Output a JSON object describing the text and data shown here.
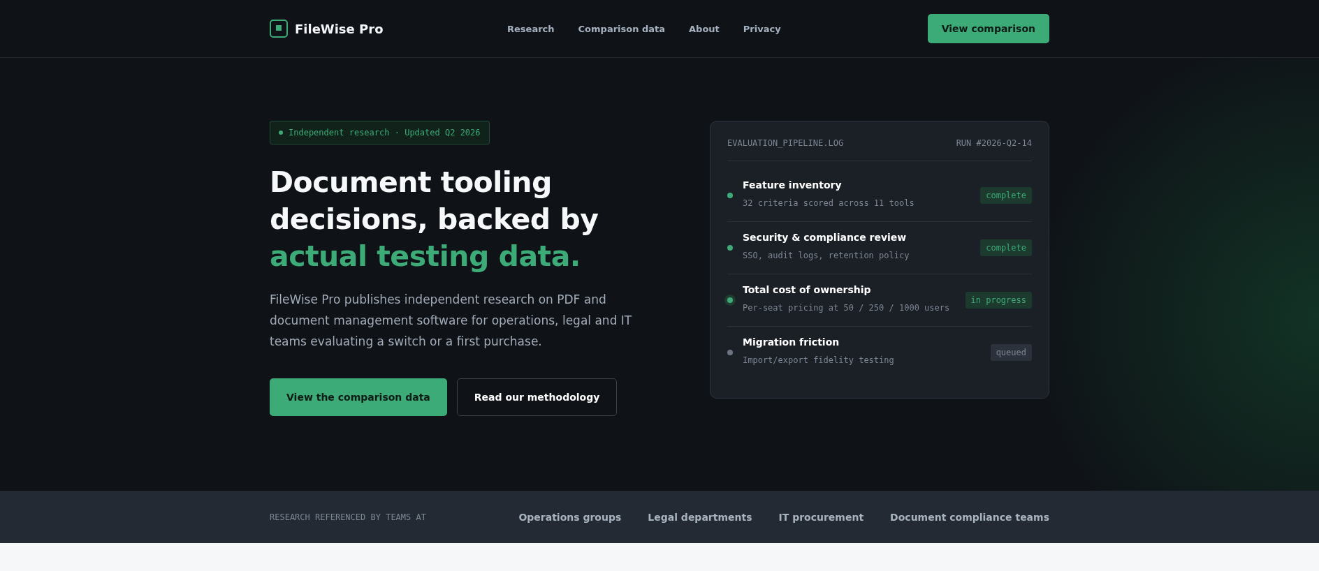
{
  "header": {
    "brand": "FileWise Pro",
    "nav": [
      "Research",
      "Comparison data",
      "About",
      "Privacy"
    ],
    "cta": "View comparison"
  },
  "hero": {
    "badge": "Independent research · Updated Q2 2026",
    "heading": "Document tooling decisions, backed by",
    "heading_accent": "actual testing data.",
    "intro": "FileWise Pro publishes independent research on PDF and document management software for operations, legal and IT teams evaluating a switch or a first purchase.",
    "primary_button": "View the comparison data",
    "secondary_button": "Read our methodology"
  },
  "panel": {
    "file": "EVALUATION_PIPELINE.LOG",
    "run": "RUN #2026-Q2-14",
    "steps": [
      {
        "title": "Feature inventory",
        "detail": "32 criteria scored across 11 tools",
        "status": "complete",
        "kind": "complete"
      },
      {
        "title": "Security & compliance review",
        "detail": "SSO, audit logs, retention policy",
        "status": "complete",
        "kind": "complete"
      },
      {
        "title": "Total cost of ownership",
        "detail": "Per-seat pricing at 50 / 250 / 1000 users",
        "status": "in progress",
        "kind": "progress"
      },
      {
        "title": "Migration friction",
        "detail": "Import/export fidelity testing",
        "status": "queued",
        "kind": "queued"
      }
    ]
  },
  "strip": {
    "label": "RESEARCH REFERENCED BY TEAMS AT",
    "teams": [
      "Operations groups",
      "Legal departments",
      "IT procurement",
      "Document compliance teams"
    ]
  }
}
